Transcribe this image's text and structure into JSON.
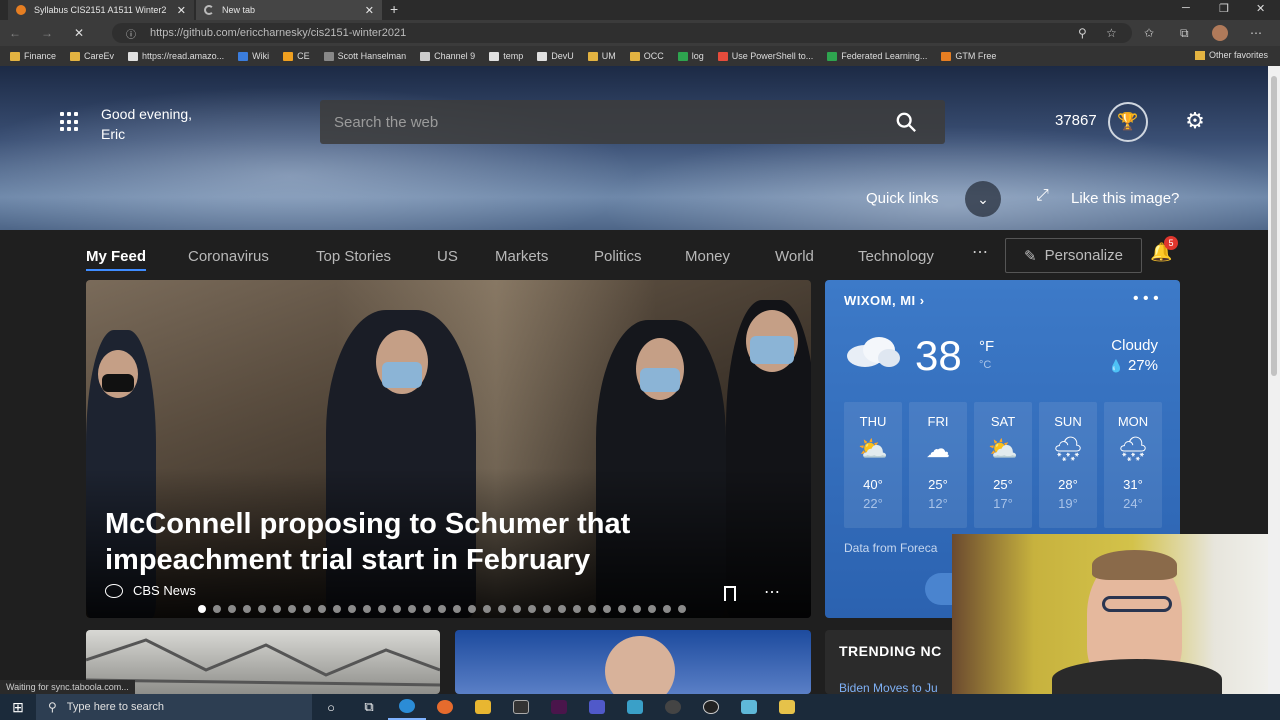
{
  "browser": {
    "tabs": [
      {
        "label": "Syllabus CIS2151 A1511 Winter2",
        "favicon_color": "#e67e22"
      },
      {
        "label": "New tab",
        "favicon_color": "#4a4a4a"
      }
    ],
    "url": "https://github.com/ericcharnesky/cis2151-winter2021",
    "favorites": [
      {
        "label": "Finance",
        "color": "#e3b341"
      },
      {
        "label": "CareEv",
        "color": "#e3b341"
      },
      {
        "label": "https://read.amazo...",
        "color": "#e0e0e0"
      },
      {
        "label": "Wiki",
        "color": "#3b7ddd"
      },
      {
        "label": "CE",
        "color": "#f0a020"
      },
      {
        "label": "Scott Hanselman",
        "color": "#888888"
      },
      {
        "label": "Channel 9",
        "color": "#cccccc"
      },
      {
        "label": "temp",
        "color": "#e0e0e0"
      },
      {
        "label": "DevU",
        "color": "#e0e0e0"
      },
      {
        "label": "UM",
        "color": "#e3b341"
      },
      {
        "label": "OCC",
        "color": "#e3b341"
      },
      {
        "label": "log",
        "color": "#2ea44f"
      },
      {
        "label": "Use PowerShell to...",
        "color": "#e74c3c"
      },
      {
        "label": "Federated Learning...",
        "color": "#2ea44f"
      },
      {
        "label": "GTM Free",
        "color": "#e67e22"
      }
    ],
    "other_favorites": "Other favorites",
    "status": "Waiting for sync.taboola.com..."
  },
  "header": {
    "greeting": "Good evening,",
    "name": "Eric",
    "search_placeholder": "Search the web",
    "points": "37867",
    "quick_links": "Quick links",
    "like_image": "Like this image?"
  },
  "feed": {
    "tabs": [
      "My Feed",
      "Coronavirus",
      "Top Stories",
      "US",
      "Markets",
      "Politics",
      "Money",
      "World",
      "Technology"
    ],
    "personalize": "Personalize",
    "notifications": "5"
  },
  "hero_story": {
    "headline": "McConnell proposing to Schumer that impeachment trial start in February",
    "source": "CBS News",
    "carousel_count": 33,
    "carousel_active": 0
  },
  "weather": {
    "location": "WIXOM, MI",
    "temp": "38",
    "unit_f": "°F",
    "unit_c": "°C",
    "condition": "Cloudy",
    "precip": "27%",
    "days": [
      {
        "day": "THU",
        "hi": "40°",
        "lo": "22°",
        "icon": "partly-sunny-icon"
      },
      {
        "day": "FRI",
        "hi": "25°",
        "lo": "12°",
        "icon": "cloud-icon"
      },
      {
        "day": "SAT",
        "hi": "25°",
        "lo": "17°",
        "icon": "partly-sunny-icon"
      },
      {
        "day": "SUN",
        "hi": "28°",
        "lo": "19°",
        "icon": "snow-sun-icon"
      },
      {
        "day": "MON",
        "hi": "31°",
        "lo": "24°",
        "icon": "snow-icon"
      }
    ],
    "source": "Data from Foreca"
  },
  "trending": {
    "title": "TRENDING NC",
    "first_item": "Biden Moves to Ju"
  },
  "taskbar": {
    "search_placeholder": "Type here to search"
  }
}
